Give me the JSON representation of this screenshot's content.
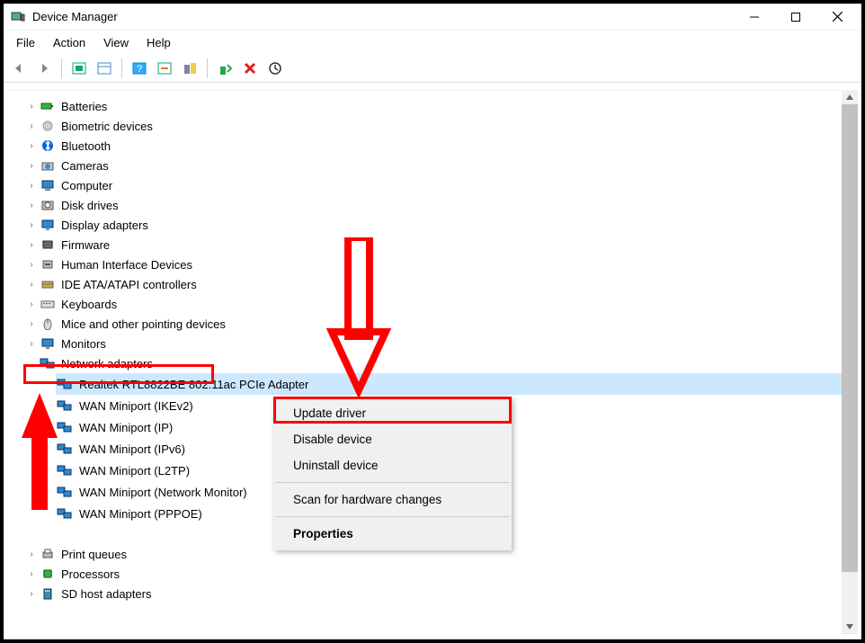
{
  "window": {
    "title": "Device Manager"
  },
  "menubar": {
    "items": [
      "File",
      "Action",
      "View",
      "Help"
    ]
  },
  "toolbar": {
    "icons": [
      "back-icon",
      "forward-icon",
      "show-hidden-icon",
      "properties-icon",
      "help-icon",
      "scan-icon",
      "legacy-icon",
      "update-icon",
      "remove-icon",
      "refresh-icon"
    ]
  },
  "tree": {
    "items": [
      {
        "label": "Batteries",
        "icon": "battery-icon",
        "expanded": false
      },
      {
        "label": "Biometric devices",
        "icon": "fingerprint-icon",
        "expanded": false
      },
      {
        "label": "Bluetooth",
        "icon": "bluetooth-icon",
        "expanded": false
      },
      {
        "label": "Cameras",
        "icon": "camera-icon",
        "expanded": false
      },
      {
        "label": "Computer",
        "icon": "computer-icon",
        "expanded": false
      },
      {
        "label": "Disk drives",
        "icon": "disk-icon",
        "expanded": false
      },
      {
        "label": "Display adapters",
        "icon": "display-icon",
        "expanded": false
      },
      {
        "label": "Firmware",
        "icon": "firmware-icon",
        "expanded": false
      },
      {
        "label": "Human Interface Devices",
        "icon": "hid-icon",
        "expanded": false
      },
      {
        "label": "IDE ATA/ATAPI controllers",
        "icon": "ide-icon",
        "expanded": false
      },
      {
        "label": "Keyboards",
        "icon": "keyboard-icon",
        "expanded": false
      },
      {
        "label": "Mice and other pointing devices",
        "icon": "mouse-icon",
        "expanded": false
      },
      {
        "label": "Monitors",
        "icon": "monitor-icon",
        "expanded": false
      },
      {
        "label": "Network adapters",
        "icon": "network-icon",
        "expanded": true,
        "highlighted": true,
        "children": [
          {
            "label": "Realtek RTL8822BE 802.11ac PCIe Adapter",
            "selected": true
          },
          {
            "label": "WAN Miniport (IKEv2)"
          },
          {
            "label": "WAN Miniport (IP)"
          },
          {
            "label": "WAN Miniport (IPv6)"
          },
          {
            "label": "WAN Miniport (L2TP)"
          },
          {
            "label": "WAN Miniport (Network Monitor)"
          },
          {
            "label": "WAN Miniport (PPPOE)"
          }
        ]
      },
      {
        "label": "Print queues",
        "icon": "printer-icon",
        "expanded": false
      },
      {
        "label": "Processors",
        "icon": "processor-icon",
        "expanded": false
      },
      {
        "label": "SD host adapters",
        "icon": "sd-icon",
        "expanded": false
      }
    ]
  },
  "context_menu": {
    "items": [
      {
        "label": "Update driver",
        "highlighted": true
      },
      {
        "label": "Disable device"
      },
      {
        "label": "Uninstall device"
      },
      {
        "sep": true
      },
      {
        "label": "Scan for hardware changes"
      },
      {
        "sep": true
      },
      {
        "label": "Properties",
        "bold": true
      }
    ]
  }
}
